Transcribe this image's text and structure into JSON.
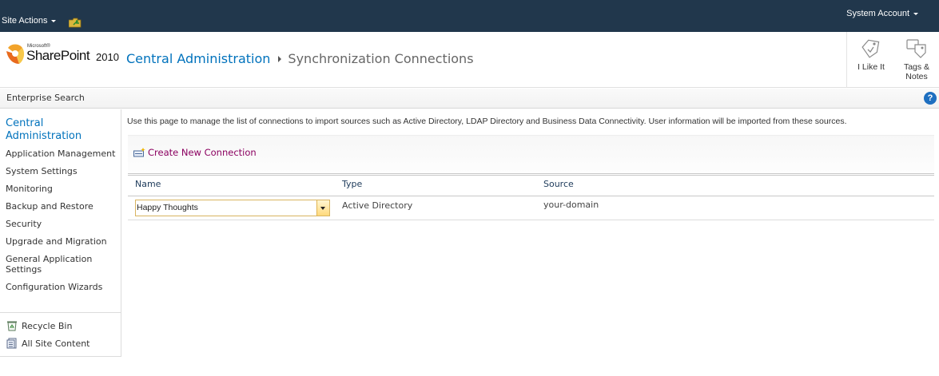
{
  "topbar": {
    "site_actions": "Site Actions",
    "user": "System Account"
  },
  "title": {
    "logo_microsoft": "Microsoft®",
    "logo_product": "SharePoint",
    "logo_version": "2010",
    "breadcrumb_root": "Central Administration",
    "breadcrumb_current": "Synchronization Connections",
    "like_label": "I Like It",
    "tags_label_1": "Tags &",
    "tags_label_2": "Notes"
  },
  "subbar": {
    "label": "Enterprise Search"
  },
  "leftnav": {
    "heading_1": "Central",
    "heading_2": "Administration",
    "items": [
      "Application Management",
      "System Settings",
      "Monitoring",
      "Backup and Restore",
      "Security",
      "Upgrade and Migration",
      "General Application Settings",
      "Configuration Wizards"
    ],
    "recycle_bin": "Recycle Bin",
    "all_site_content": "All Site Content"
  },
  "main": {
    "description": "Use this page to manage the list of connections to import sources such as Active Directory, LDAP Directory and Business Data Connectivity. User information will be imported from these sources.",
    "create_link": "Create New Connection",
    "columns": [
      "Name",
      "Type",
      "Source"
    ],
    "rows": [
      {
        "name": "Happy Thoughts",
        "type": "Active Directory",
        "source": "your-domain"
      }
    ]
  },
  "colors": {
    "topbar_bg": "#21374c",
    "link_blue": "#0072bc",
    "create_link": "#8b0060"
  }
}
